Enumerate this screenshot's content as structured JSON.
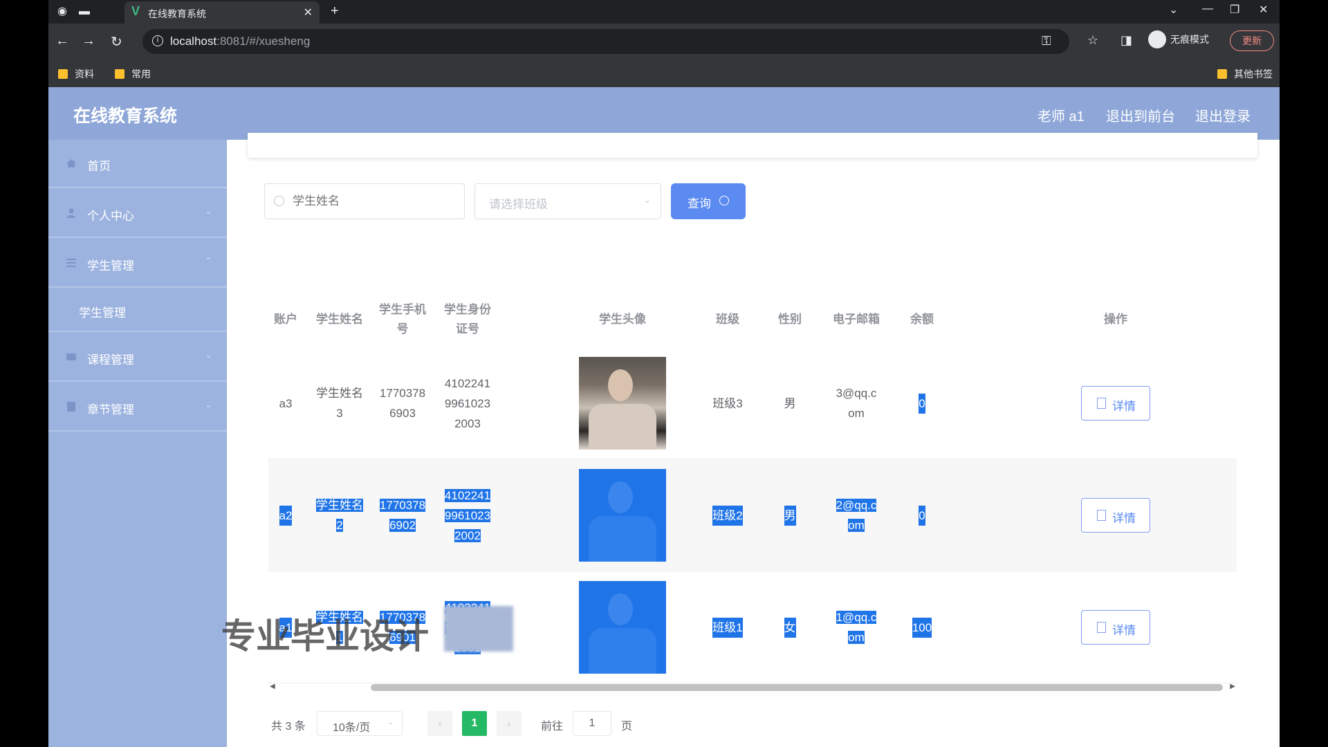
{
  "browser": {
    "tab_title": "在线教育系统",
    "url_host": "localhost",
    "url_path": ":8081/#/xuesheng",
    "incognito_label": "无痕模式",
    "update_label": "更新",
    "bookmarks": [
      "资料",
      "常用"
    ],
    "other_bookmarks": "其他书签"
  },
  "header": {
    "title": "在线教育系统",
    "user": "老师 a1",
    "to_front": "退出到前台",
    "logout": "退出登录"
  },
  "sidebar": {
    "items": [
      {
        "label": "首页",
        "icon": "home-icon"
      },
      {
        "label": "个人中心",
        "icon": "user-icon"
      },
      {
        "label": "学生管理",
        "icon": "menu-icon"
      },
      {
        "label": "学生管理",
        "sub": true
      },
      {
        "label": "课程管理",
        "icon": "course-icon"
      },
      {
        "label": "章节管理",
        "icon": "chapter-icon"
      }
    ]
  },
  "search": {
    "name_placeholder": "学生姓名",
    "class_placeholder": "请选择班级",
    "query_label": "查询"
  },
  "table": {
    "headers": [
      "账户",
      "学生姓名",
      "学生手机号",
      "学生身份证号",
      "学生头像",
      "班级",
      "性别",
      "电子邮箱",
      "余额",
      "操作"
    ],
    "header_lines": {
      "phone": [
        "学生手机",
        "号"
      ],
      "idcard": [
        "学生身份",
        "证号"
      ]
    },
    "rows": [
      {
        "account": "a3",
        "name": [
          "学生姓名",
          "3"
        ],
        "phone": [
          "1770378",
          "6903"
        ],
        "idcard": [
          "4102241",
          "9961023",
          "2003"
        ],
        "class": "班级3",
        "gender": "男",
        "email": [
          "3@qq.c",
          "om"
        ],
        "balance": "0",
        "detail": "详情"
      },
      {
        "account": "a2",
        "name": [
          "学生姓名",
          "2"
        ],
        "phone": [
          "1770378",
          "6902"
        ],
        "idcard": [
          "4102241",
          "9961023",
          "2002"
        ],
        "class": "班级2",
        "gender": "男",
        "email": [
          "2@qq.c",
          "om"
        ],
        "balance": "0",
        "detail": "详情"
      },
      {
        "account": "a1",
        "name": [
          "学生姓名",
          "1"
        ],
        "phone": [
          "1770378",
          "6901"
        ],
        "idcard": [
          "4102241",
          "9961023",
          "2001"
        ],
        "class": "班级1",
        "gender": "女",
        "email": [
          "1@qq.c",
          "om"
        ],
        "balance": "100",
        "detail": "详情"
      }
    ]
  },
  "pagination": {
    "total": "共 3 条",
    "page_size": "10条/页",
    "prev": "‹",
    "current": "1",
    "next": "›",
    "goto": "前往",
    "goto_value": "1",
    "unit": "页"
  },
  "overlay": {
    "watermark": "专业毕业设计"
  }
}
